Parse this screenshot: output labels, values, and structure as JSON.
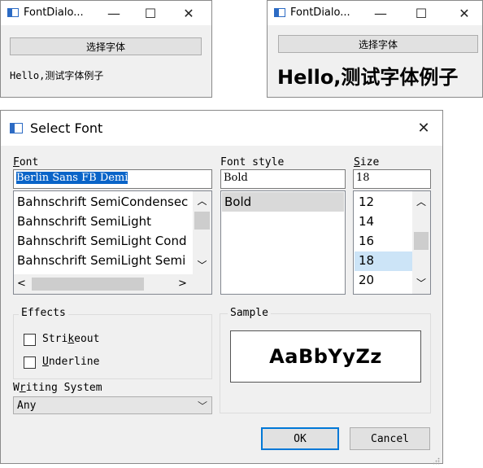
{
  "small_window_1": {
    "title": "FontDialo...",
    "button": "选择字体",
    "sample_text": "Hello,测试字体例子",
    "controls": {
      "minimize": "—",
      "maximize": "☐",
      "close": "✕"
    }
  },
  "small_window_2": {
    "title": "FontDialo...",
    "button": "选择字体",
    "sample_text": "Hello,测试字体例子",
    "controls": {
      "minimize": "—",
      "maximize": "☐",
      "close": "✕"
    }
  },
  "dialog": {
    "title": "Select Font",
    "close": "✕",
    "font": {
      "label_mnemonic": "F",
      "label_rest": "ont",
      "value": "Berlin Sans FB Demi",
      "items": [
        "Bahnschrift SemiCondensec",
        "Bahnschrift SemiLight",
        "Bahnschrift SemiLight Cond",
        "Bahnschrift SemiLight Semi"
      ]
    },
    "style": {
      "label": "Font style",
      "value": "Bold",
      "items": [
        "Bold"
      ],
      "selected": "Bold"
    },
    "size": {
      "label_mnemonic": "S",
      "label_rest": "ize",
      "value": "18",
      "items": [
        "12",
        "14",
        "16",
        "18",
        "20"
      ],
      "selected": "18"
    },
    "effects": {
      "title": "Effects",
      "strikeout": {
        "pre": "Stri",
        "mnemonic": "k",
        "post": "eout",
        "checked": false
      },
      "underline": {
        "pre": "",
        "mnemonic": "U",
        "post": "nderline",
        "checked": false
      }
    },
    "writing_system": {
      "pre": "W",
      "mnemonic": "r",
      "post": "iting System",
      "value": "Any"
    },
    "sample": {
      "title": "Sample",
      "text": "AaBbYyZz"
    },
    "ok": "OK",
    "cancel": "Cancel"
  }
}
